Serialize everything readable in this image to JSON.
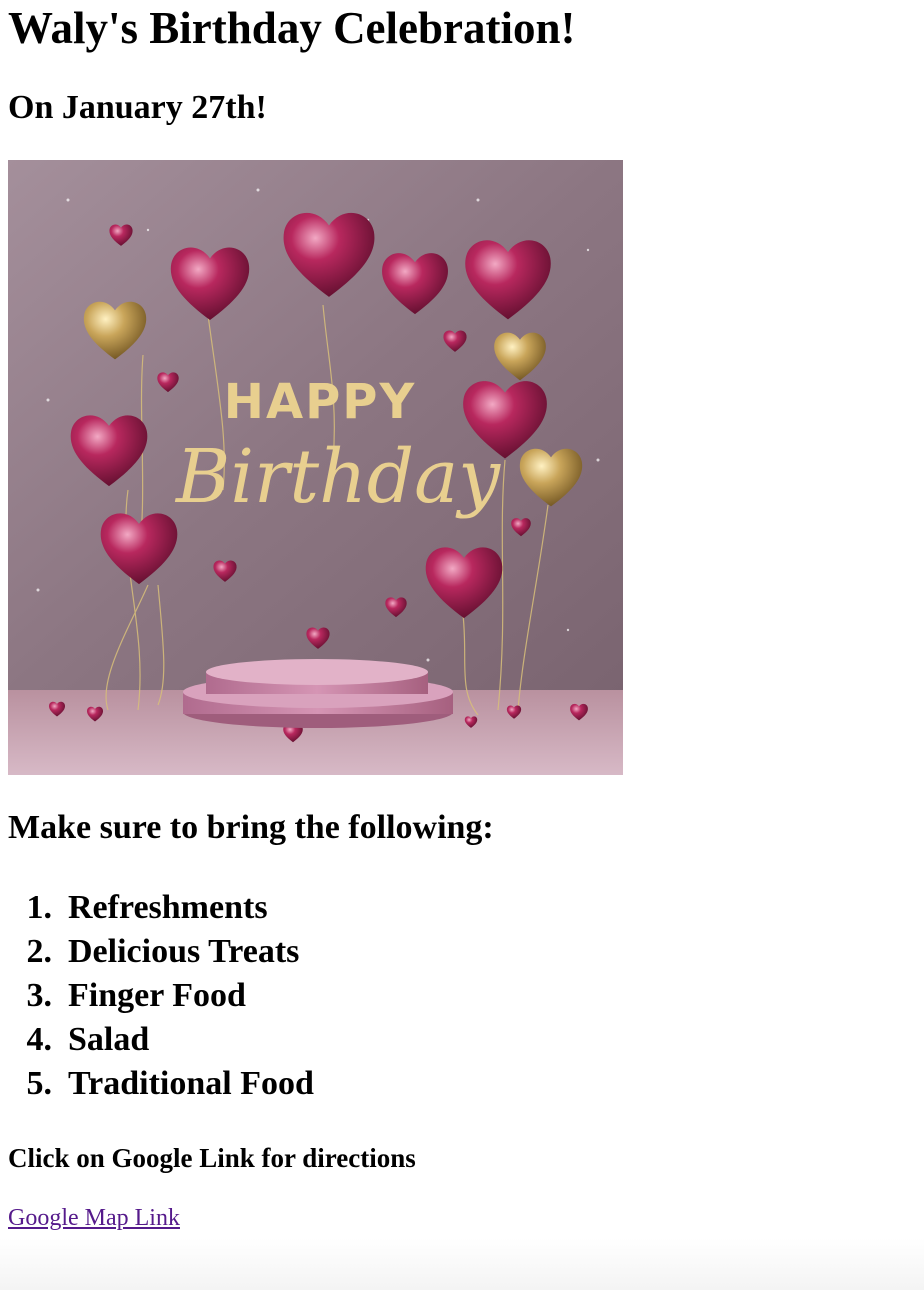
{
  "page": {
    "title": "Waly's Birthday Celebration!",
    "date": "On January 27th!"
  },
  "banner": {
    "alt": "Happy Birthday balloons banner",
    "line1": "HAPPY",
    "line2": "Birthday",
    "colors": {
      "wall": "#8f7a86",
      "floor": "#c8a6b6",
      "balloon_pink": "#a0204f",
      "balloon_gold": "#c9a55a",
      "text_gold": "#e8cf8f"
    }
  },
  "bring": {
    "heading": "Make sure to bring the following:",
    "items": [
      {
        "num": "1.",
        "label": "Refreshments"
      },
      {
        "num": "2.",
        "label": "Delicious Treats"
      },
      {
        "num": "3.",
        "label": "Finger Food"
      },
      {
        "num": "4.",
        "label": "Salad"
      },
      {
        "num": "5.",
        "label": "Traditional Food"
      }
    ]
  },
  "directions": {
    "text": "Click on Google Link for directions",
    "link_label": "Google Map Link",
    "link_color": "#551a8b"
  }
}
